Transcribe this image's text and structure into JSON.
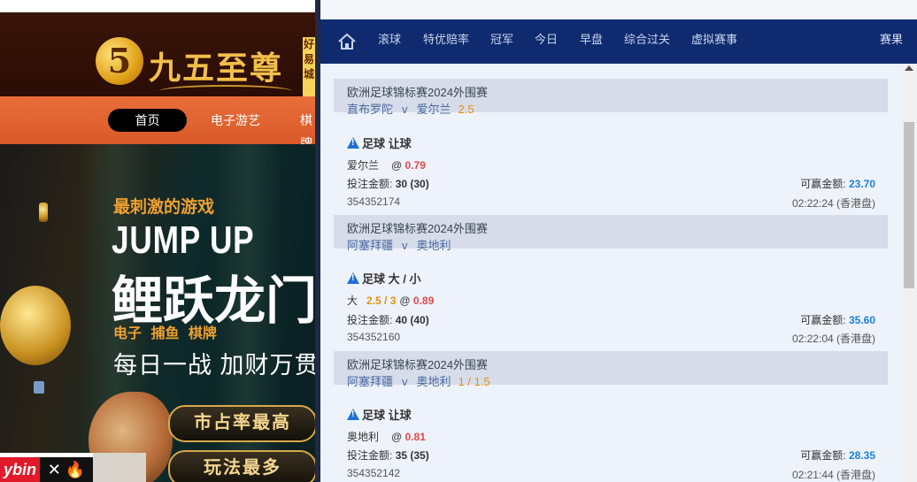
{
  "left_site": {
    "logo_numeral": "5",
    "logo_text": "九五至尊",
    "logo_side_text": "好\n易\n城",
    "nav": {
      "home": "首页",
      "items": [
        "电子游艺",
        "棋牌"
      ]
    },
    "banner": {
      "tag": "最刺激的游戏",
      "title_en": "JUMP UP",
      "title_cn": "鲤跃龙门",
      "categories": "电子 捕鱼 棋牌",
      "slogan": "每日一战 加财万贯",
      "buttons": [
        "市占率最高",
        "玩法最多"
      ],
      "bottom_left": "ybin",
      "bottom_mid": "✕ 🔥"
    }
  },
  "right_panel": {
    "nav": {
      "items": [
        "滚球",
        "特优赔率",
        "冠军",
        "今日",
        "早盘",
        "综合过关",
        "虚拟赛事"
      ],
      "right": "赛果"
    },
    "bets": [
      {
        "league": "欧洲足球锦标赛2024外围赛",
        "home": "直布罗陀",
        "v": "v",
        "away": "爱尔兰",
        "header_handicap": "2.5",
        "title": "足球 让球",
        "selection": "爱尔兰",
        "line": "",
        "at": "@",
        "odds": "0.79",
        "stake_label": "投注金额:",
        "stake": "30 (30)",
        "win_label": "可赢金额:",
        "win": "23.70",
        "id": "354352174",
        "time": "02:22:24 (香港盘)"
      },
      {
        "league": "欧洲足球锦标赛2024外围赛",
        "home": "阿塞拜疆",
        "v": "v",
        "away": "奥地利",
        "header_handicap": "",
        "title": "足球 大 / 小",
        "selection": "大",
        "line": "2.5 / 3",
        "at": "@",
        "odds": "0.89",
        "stake_label": "投注金额:",
        "stake": "40 (40)",
        "win_label": "可赢金额:",
        "win": "35.60",
        "id": "354352160",
        "time": "02:22:04 (香港盘)"
      },
      {
        "league": "欧洲足球锦标赛2024外围赛",
        "home": "阿塞拜疆",
        "v": "v",
        "away": "奥地利",
        "header_handicap": "1 / 1.5",
        "title": "足球 让球",
        "selection": "奥地利",
        "line": "",
        "at": "@",
        "odds": "0.81",
        "stake_label": "投注金额:",
        "stake": "35 (35)",
        "win_label": "可赢金额:",
        "win": "28.35",
        "id": "354352142",
        "time": "02:21:44 (香港盘)"
      }
    ]
  },
  "colors": {
    "nav_bg": "#0f2a6e",
    "header_box": "#d6dcea",
    "odds": "#e04a4a",
    "handicap": "#e8900a",
    "win_amount": "#1e7fd9",
    "site_nav": "#e06430"
  }
}
